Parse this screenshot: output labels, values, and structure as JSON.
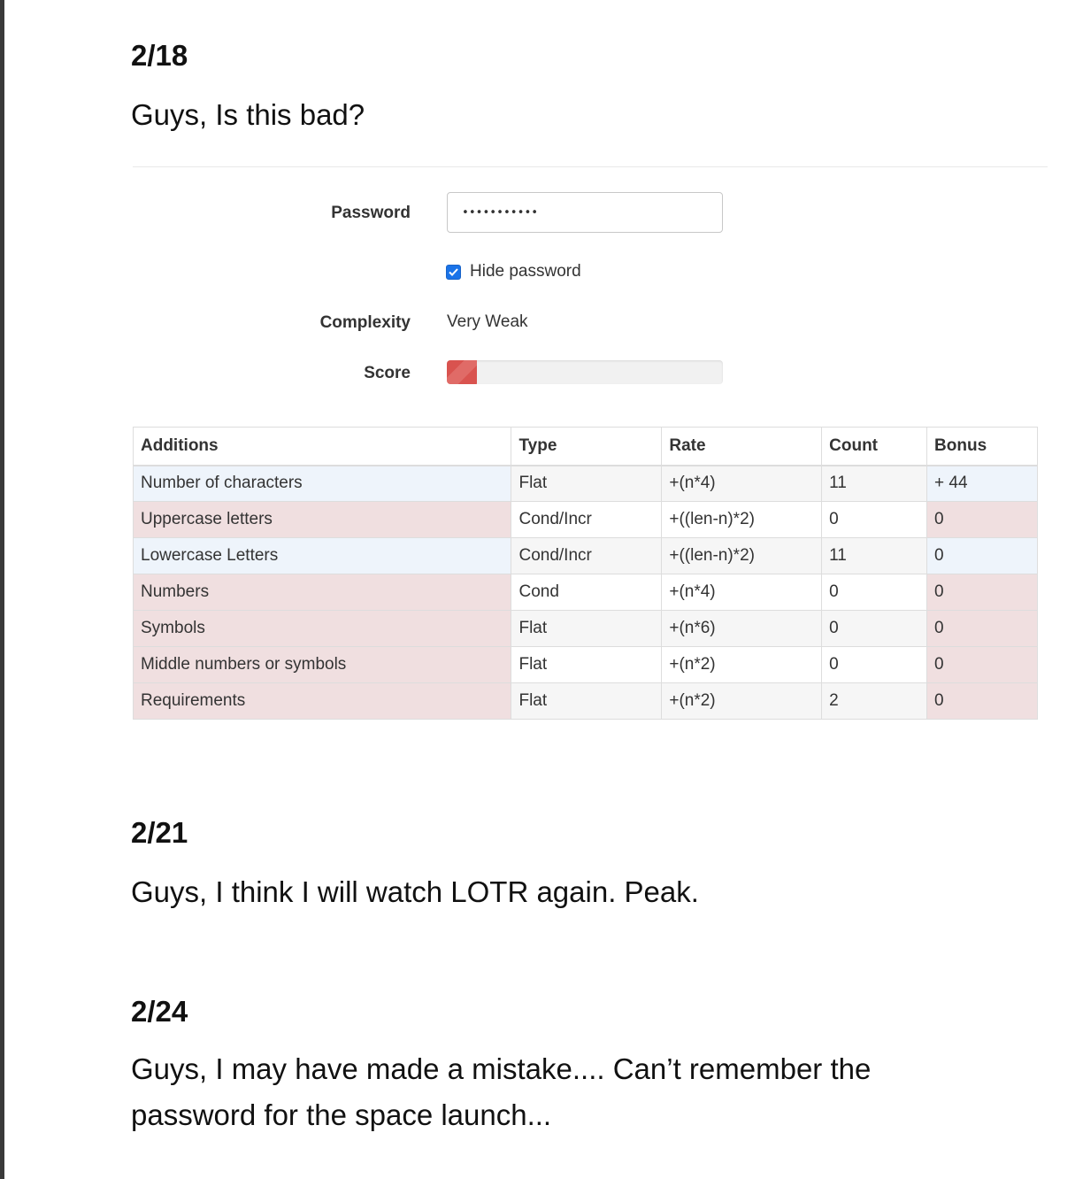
{
  "posts": [
    {
      "date": "2/18",
      "text": "Guys, Is this bad?"
    },
    {
      "date": "2/21",
      "text": "Guys, I think I will watch LOTR again. Peak."
    },
    {
      "date": "2/24",
      "text": "Guys, I may have made a mistake.... Can’t remember the password for the space launch..."
    }
  ],
  "form": {
    "password_label": "Password",
    "password_value": "•••••••••••",
    "hide_password_label": "Hide password",
    "hide_password_checked": true,
    "complexity_label": "Complexity",
    "complexity_value": "Very Weak",
    "score_label": "Score",
    "score_fraction": 0.11
  },
  "colors": {
    "ok_row": "#eef4fb",
    "bad_row": "#f0dfe0",
    "score_bar": "#d9534f",
    "checkbox": "#1a73e8"
  },
  "table": {
    "headers": [
      "Additions",
      "Type",
      "Rate",
      "Count",
      "Bonus"
    ],
    "rows": [
      {
        "status": "ok",
        "cells": [
          "Number of characters",
          "Flat",
          "+(n*4)",
          "11",
          "+ 44"
        ]
      },
      {
        "status": "bad",
        "cells": [
          "Uppercase letters",
          "Cond/Incr",
          "+((len-n)*2)",
          "0",
          "0"
        ]
      },
      {
        "status": "ok",
        "cells": [
          "Lowercase Letters",
          "Cond/Incr",
          "+((len-n)*2)",
          "11",
          "0"
        ]
      },
      {
        "status": "bad",
        "cells": [
          "Numbers",
          "Cond",
          "+(n*4)",
          "0",
          "0"
        ]
      },
      {
        "status": "bad",
        "cells": [
          "Symbols",
          "Flat",
          "+(n*6)",
          "0",
          "0"
        ]
      },
      {
        "status": "bad",
        "cells": [
          "Middle numbers or symbols",
          "Flat",
          "+(n*2)",
          "0",
          "0"
        ]
      },
      {
        "status": "bad",
        "cells": [
          "Requirements",
          "Flat",
          "+(n*2)",
          "2",
          "0"
        ]
      }
    ]
  }
}
